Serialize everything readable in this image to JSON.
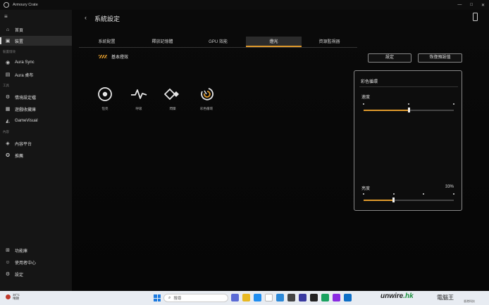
{
  "window": {
    "app_title": "Armoury Crate",
    "controls": [
      "—",
      "□",
      "✕"
    ]
  },
  "sidebar": {
    "items_top": [
      {
        "label": "首頁",
        "icon": "home-icon"
      },
      {
        "label": "裝置",
        "icon": "device-icon",
        "active": true
      }
    ],
    "section_device": "裝置燈效",
    "items_light": [
      {
        "label": "Aura Sync",
        "icon": "aura-sync-icon"
      },
      {
        "label": "Aura 桌布",
        "icon": "aura-wallpaper-icon"
      }
    ],
    "section_tools": "工具",
    "items_tools": [
      {
        "label": "情境設定檔",
        "icon": "scenario-profile-icon"
      },
      {
        "label": "遊戲收藏庫",
        "icon": "game-library-icon"
      },
      {
        "label": "GameVisual",
        "icon": "gamevisual-icon"
      }
    ],
    "section_content": "內容",
    "items_content": [
      {
        "label": "內容平台",
        "icon": "content-platform-icon"
      },
      {
        "label": "推薦",
        "icon": "recommend-icon"
      }
    ],
    "items_bottom": [
      {
        "label": "功能庫",
        "icon": "feature-library-icon"
      },
      {
        "label": "使用者中心",
        "icon": "user-center-icon"
      },
      {
        "label": "設定",
        "icon": "settings-icon"
      }
    ]
  },
  "main": {
    "page_title": "系統設定",
    "tabs": [
      {
        "label": "系統配置"
      },
      {
        "label": "釋放記憶體"
      },
      {
        "label": "GPU 效能"
      },
      {
        "label": "燈光",
        "active": true
      },
      {
        "label": "資源監視器"
      }
    ],
    "section_title": "基本燈效",
    "buttons": {
      "setting": "設定",
      "restore": "恢復預設值"
    },
    "effects": [
      {
        "label": "恆亮",
        "icon": "static-icon"
      },
      {
        "label": "呼吸",
        "icon": "breathing-icon"
      },
      {
        "label": "閃爍",
        "icon": "strobe-icon"
      },
      {
        "label": "彩色循環",
        "icon": "color-cycle-icon"
      }
    ],
    "panel": {
      "title": "彩色循環",
      "speed_label": "速度",
      "speed_level": 0.5,
      "speed_positions": 3,
      "brightness_label": "亮度",
      "brightness_value": "33%",
      "brightness_level": 0.33,
      "brightness_positions": 4
    }
  },
  "taskbar": {
    "weather_temp": "30°C",
    "weather_desc": "晴朗",
    "search_placeholder": "搜尋",
    "watermark_brand": "unwire",
    "watermark_suffix": ".hk",
    "watermark_cn": "電腦王",
    "watermark_sub": "香港科技"
  },
  "colors": {
    "accent": "#e09a2c",
    "sidebar_bg": "#151515",
    "main_bg": "#0a0a0a"
  }
}
